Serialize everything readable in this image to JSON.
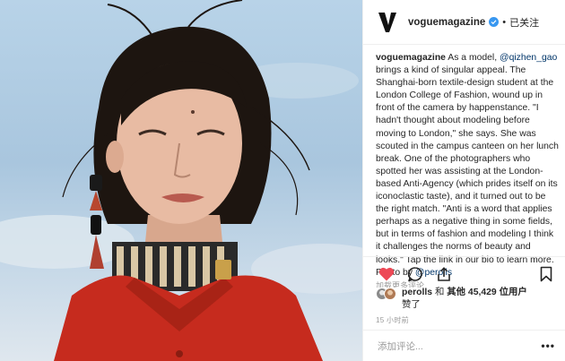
{
  "post": {
    "username": "voguemagazine",
    "follow_label": "已关注",
    "separator": "•",
    "caption": {
      "username": "voguemagazine",
      "intro": " As a model, ",
      "mention1": "@qizhen_gao",
      "body": " brings a kind of singular appeal. The Shanghai-born textile-design student at the London College of Fashion, wound up in front of the camera by happenstance. \"I hadn't thought about modeling before moving to London,\" she says. She was scouted in the campus canteen on her lunch break. One of the photographers who spotted her was assisting at the London-based Anti-Agency (which prides itself on its iconoclastic taste), and it turned out to be the right match. \"Anti is a word that applies perhaps as a negative thing in some fields, but in terms of fashion and modeling I think it challenges the norms of beauty and looks.\" Tap the link in our bio to learn more. Photo by ",
      "mention2": "@perolls",
      "faded_line": "加载更多评论"
    },
    "likes": {
      "liker": "perolls",
      "and": " 和 ",
      "others": "其他 45,429 位用户",
      "liked": "赞了"
    },
    "timestamp": "15 小时前",
    "comment_placeholder": "添加评论...",
    "more_label": "•••"
  },
  "icons": {
    "brand_logo": "vogue-v-logo",
    "verified": "verified-badge-icon",
    "like": "heart-icon",
    "comment": "comment-icon",
    "share": "share-icon",
    "save": "bookmark-icon"
  },
  "colors": {
    "like_red": "#ed4956",
    "verified_blue": "#3897f0",
    "mention_blue": "#003569",
    "muted_gray": "#999999",
    "divider": "#efefef"
  }
}
